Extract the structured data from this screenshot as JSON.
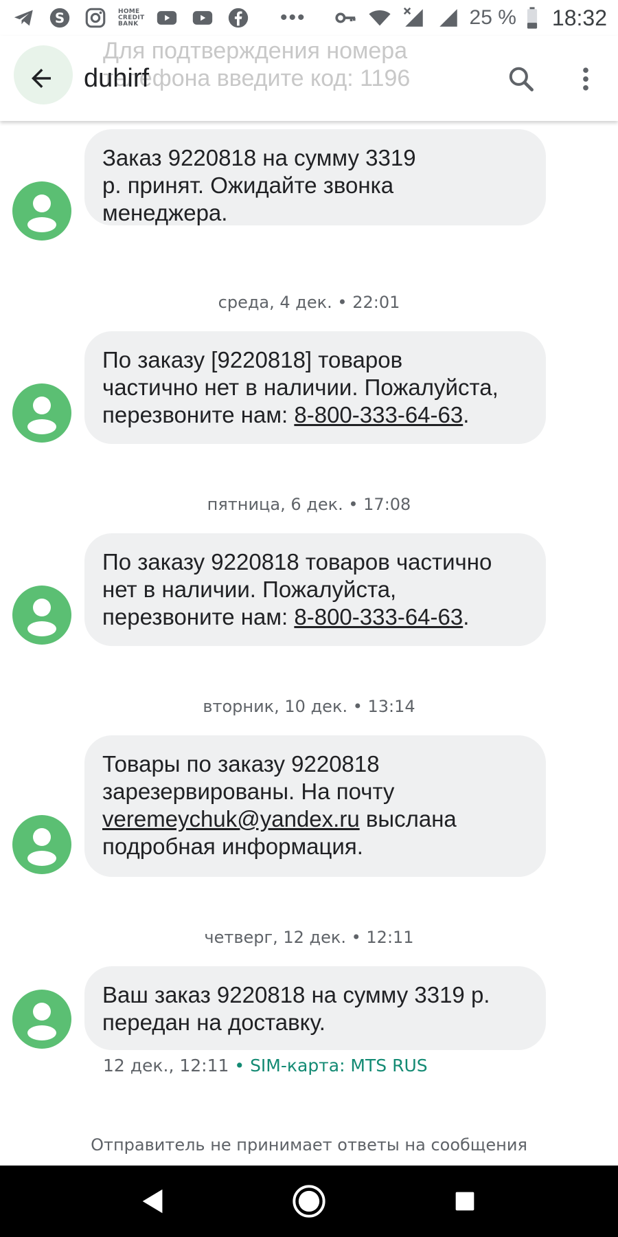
{
  "status_bar": {
    "icons": [
      "telegram-icon",
      "skype-icon",
      "instagram-icon",
      "home-credit-bank-icon",
      "youtube-icon",
      "youtube-icon",
      "facebook-icon"
    ],
    "bank_label": "HOME\nCREDIT\nBANK",
    "overflow": "•••",
    "battery_text": "25 %",
    "time": "18:32"
  },
  "app_bar": {
    "title": "duhirf",
    "ghost_text": "Для подтверждения номера\nтелефона введите код: 1196"
  },
  "messages": [
    {
      "date": "",
      "text": "Заказ 9220818 на сумму 3319\nр. принят. Ожидайте звонка\nменеджера."
    },
    {
      "date": "среда, 4 дек. • 22:01",
      "text_before": "По заказу [9220818] товаров\nчастично нет в наличии. Пожалуйста,\nперезвоните нам: ",
      "link": "8-800-333-64-63",
      "text_after": "."
    },
    {
      "date": "пятница, 6 дек. • 17:08",
      "text_before": "По заказу 9220818 товаров частично\nнет в наличии. Пожалуйста,\nперезвоните нам: ",
      "link": "8-800-333-64-63",
      "text_after": "."
    },
    {
      "date": "вторник, 10 дек. • 13:14",
      "text_before": "Товары по заказу 9220818\nзарезервированы. На почту\n",
      "link": "veremeychuk@yandex.ru",
      "text_after": " выслана\nподробная информация."
    },
    {
      "date": "четверг, 12 дек. • 12:11",
      "text": "Ваш заказ 9220818 на сумму 3319 р.\nпередан на доставку."
    }
  ],
  "last_meta": {
    "timestamp": "12 дек., 12:11",
    "separator": " • ",
    "sim": "SIM-карта: MTS RUS"
  },
  "footer_note": "Отправитель не принимает ответы на сообщения",
  "colors": {
    "avatar": "#5bbf73",
    "bubble": "#eff0f1",
    "sim": "#138a73"
  }
}
